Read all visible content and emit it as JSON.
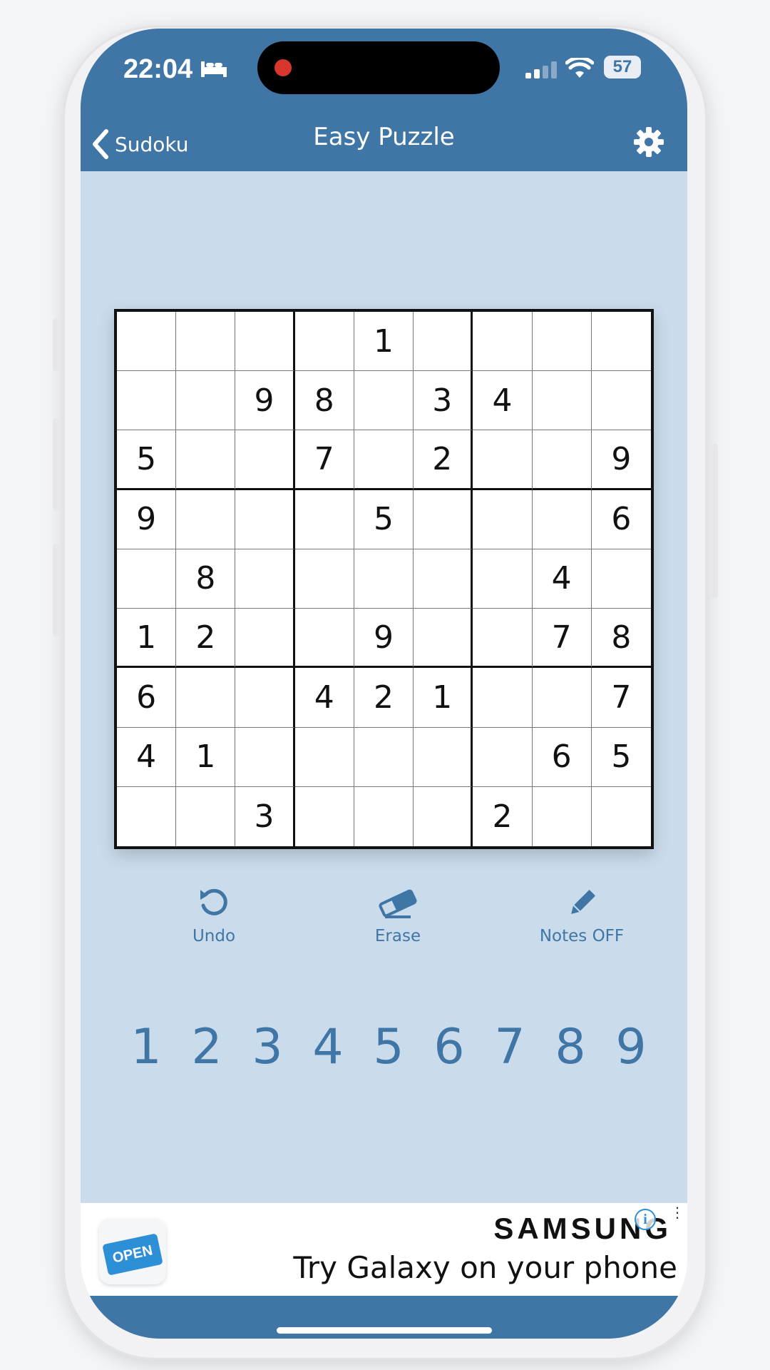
{
  "status_bar": {
    "time": "22:04",
    "battery": "57"
  },
  "nav": {
    "back_label": "Sudoku",
    "title": "Easy Puzzle"
  },
  "board": {
    "rows": [
      [
        "",
        "",
        "",
        "",
        "1",
        "",
        "",
        "",
        ""
      ],
      [
        "",
        "",
        "9",
        "8",
        "",
        "3",
        "4",
        "",
        ""
      ],
      [
        "5",
        "",
        "",
        "7",
        "",
        "2",
        "",
        "",
        "9"
      ],
      [
        "9",
        "",
        "",
        "",
        "5",
        "",
        "",
        "",
        "6"
      ],
      [
        "",
        "8",
        "",
        "",
        "",
        "",
        "",
        "4",
        ""
      ],
      [
        "1",
        "2",
        "",
        "",
        "9",
        "",
        "",
        "7",
        "8"
      ],
      [
        "6",
        "",
        "",
        "4",
        "2",
        "1",
        "",
        "",
        "7"
      ],
      [
        "4",
        "1",
        "",
        "",
        "",
        "",
        "",
        "6",
        "5"
      ],
      [
        "",
        "",
        "3",
        "",
        "",
        "",
        "2",
        "",
        ""
      ]
    ]
  },
  "tools": {
    "undo": "Undo",
    "erase": "Erase",
    "notes": "Notes OFF"
  },
  "numpad": [
    "1",
    "2",
    "3",
    "4",
    "5",
    "6",
    "7",
    "8",
    "9"
  ],
  "ad": {
    "sign_text": "OPEN",
    "brand": "SAMSUNG",
    "tagline": "Try Galaxy on your phone"
  },
  "colors": {
    "primary": "#3f76a6",
    "background": "#cadcec",
    "board": "#ffffff"
  }
}
